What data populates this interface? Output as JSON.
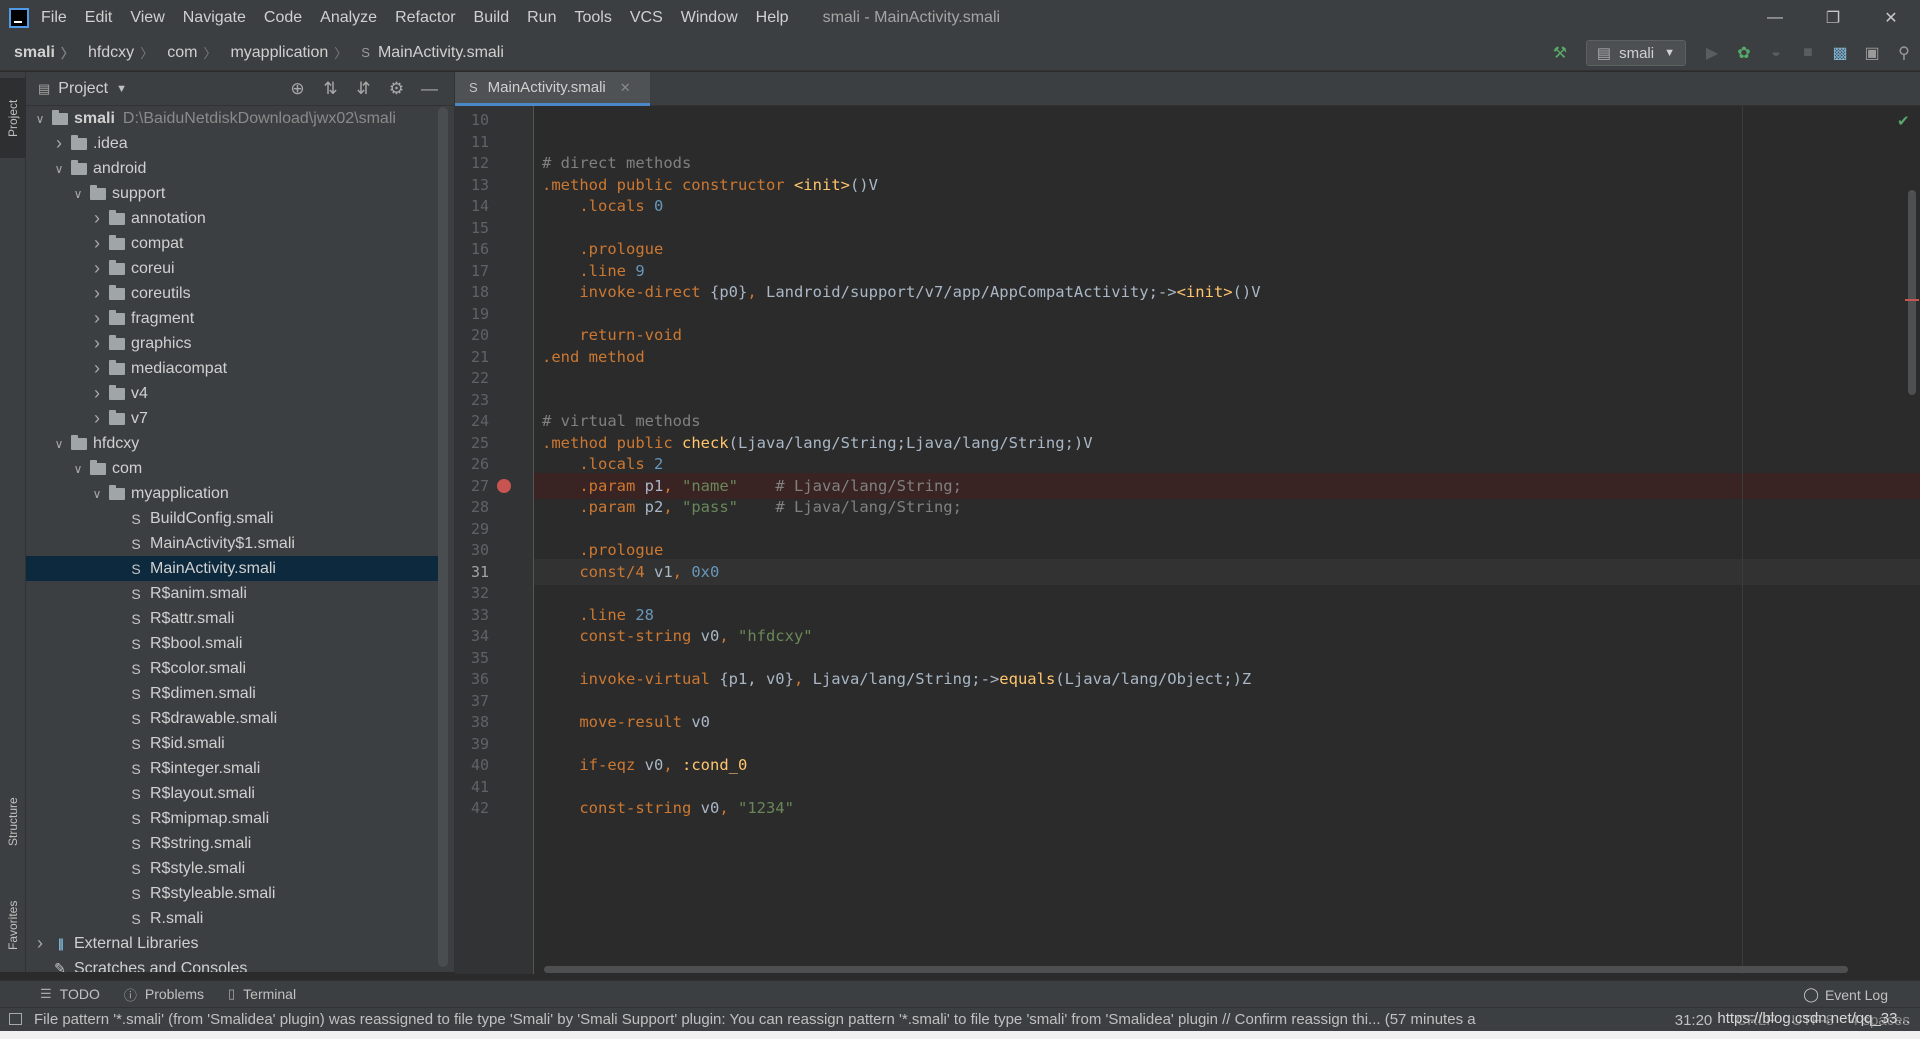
{
  "title_bar": {
    "menus": [
      "File",
      "Edit",
      "View",
      "Navigate",
      "Code",
      "Analyze",
      "Refactor",
      "Build",
      "Run",
      "Tools",
      "VCS",
      "Window",
      "Help"
    ],
    "window_title": "smali - MainActivity.smali"
  },
  "breadcrumb": [
    "smali",
    "hfdcxy",
    "com",
    "myapplication",
    "MainActivity.smali"
  ],
  "run_config": "smali",
  "left_strip": {
    "project": "Project",
    "structure": "Structure",
    "favorites": "Favorites"
  },
  "project_panel": {
    "title": "Project",
    "tree": [
      {
        "label": "smali",
        "path": "D:\\BaiduNetdiskDownload\\jwx02\\smali",
        "kind": "module",
        "depth": 0,
        "expanded": true
      },
      {
        "label": ".idea",
        "kind": "folder",
        "depth": 1,
        "expanded": false
      },
      {
        "label": "android",
        "kind": "folder",
        "depth": 1,
        "expanded": true
      },
      {
        "label": "support",
        "kind": "folder",
        "depth": 2,
        "expanded": true
      },
      {
        "label": "annotation",
        "kind": "folder",
        "depth": 3,
        "expanded": false
      },
      {
        "label": "compat",
        "kind": "folder",
        "depth": 3,
        "expanded": false
      },
      {
        "label": "coreui",
        "kind": "folder",
        "depth": 3,
        "expanded": false
      },
      {
        "label": "coreutils",
        "kind": "folder",
        "depth": 3,
        "expanded": false
      },
      {
        "label": "fragment",
        "kind": "folder",
        "depth": 3,
        "expanded": false
      },
      {
        "label": "graphics",
        "kind": "folder",
        "depth": 3,
        "expanded": false
      },
      {
        "label": "mediacompat",
        "kind": "folder",
        "depth": 3,
        "expanded": false
      },
      {
        "label": "v4",
        "kind": "folder",
        "depth": 3,
        "expanded": false
      },
      {
        "label": "v7",
        "kind": "folder",
        "depth": 3,
        "expanded": false
      },
      {
        "label": "hfdcxy",
        "kind": "folder",
        "depth": 1,
        "expanded": true
      },
      {
        "label": "com",
        "kind": "folder",
        "depth": 2,
        "expanded": true
      },
      {
        "label": "myapplication",
        "kind": "folder",
        "depth": 3,
        "expanded": true
      },
      {
        "label": "BuildConfig.smali",
        "kind": "file",
        "depth": 4
      },
      {
        "label": "MainActivity$1.smali",
        "kind": "file",
        "depth": 4
      },
      {
        "label": "MainActivity.smali",
        "kind": "file",
        "depth": 4,
        "selected": true
      },
      {
        "label": "R$anim.smali",
        "kind": "file",
        "depth": 4
      },
      {
        "label": "R$attr.smali",
        "kind": "file",
        "depth": 4
      },
      {
        "label": "R$bool.smali",
        "kind": "file",
        "depth": 4
      },
      {
        "label": "R$color.smali",
        "kind": "file",
        "depth": 4
      },
      {
        "label": "R$dimen.smali",
        "kind": "file",
        "depth": 4
      },
      {
        "label": "R$drawable.smali",
        "kind": "file",
        "depth": 4
      },
      {
        "label": "R$id.smali",
        "kind": "file",
        "depth": 4
      },
      {
        "label": "R$integer.smali",
        "kind": "file",
        "depth": 4
      },
      {
        "label": "R$layout.smali",
        "kind": "file",
        "depth": 4
      },
      {
        "label": "R$mipmap.smali",
        "kind": "file",
        "depth": 4
      },
      {
        "label": "R$string.smali",
        "kind": "file",
        "depth": 4
      },
      {
        "label": "R$style.smali",
        "kind": "file",
        "depth": 4
      },
      {
        "label": "R$styleable.smali",
        "kind": "file",
        "depth": 4
      },
      {
        "label": "R.smali",
        "kind": "file",
        "depth": 4
      },
      {
        "label": "External Libraries",
        "kind": "library",
        "depth": 0,
        "expanded": false
      },
      {
        "label": "Scratches and Consoles",
        "kind": "scratch",
        "depth": 0
      }
    ]
  },
  "editor": {
    "tab_label": "MainActivity.smali",
    "breakpoint_line": 27,
    "current_line": 31,
    "lines": [
      {
        "n": 10,
        "tokens": []
      },
      {
        "n": 11,
        "tokens": []
      },
      {
        "n": 12,
        "tokens": [
          {
            "t": "# direct methods",
            "c": "cm"
          }
        ]
      },
      {
        "n": 13,
        "tokens": [
          {
            "t": ".method public constructor ",
            "c": "kw"
          },
          {
            "t": "<init>",
            "c": "fn"
          },
          {
            "t": "()V",
            "c": "type"
          }
        ]
      },
      {
        "n": 14,
        "tokens": [
          {
            "t": "    .locals ",
            "c": "kw"
          },
          {
            "t": "0",
            "c": "num"
          }
        ]
      },
      {
        "n": 15,
        "tokens": []
      },
      {
        "n": 16,
        "tokens": [
          {
            "t": "    .prologue",
            "c": "kw"
          }
        ]
      },
      {
        "n": 17,
        "tokens": [
          {
            "t": "    .line ",
            "c": "kw"
          },
          {
            "t": "9",
            "c": "num"
          }
        ]
      },
      {
        "n": 18,
        "tokens": [
          {
            "t": "    invoke-direct ",
            "c": "kw"
          },
          {
            "t": "{p0}",
            "c": "type"
          },
          {
            "t": ", ",
            "c": "kw"
          },
          {
            "t": "Landroid/support/v7/app/AppCompatActivity;->",
            "c": "type"
          },
          {
            "t": "<init>",
            "c": "fn"
          },
          {
            "t": "()V",
            "c": "type"
          }
        ]
      },
      {
        "n": 19,
        "tokens": []
      },
      {
        "n": 20,
        "tokens": [
          {
            "t": "    return-void",
            "c": "kw"
          }
        ]
      },
      {
        "n": 21,
        "tokens": [
          {
            "t": ".end method",
            "c": "kw"
          }
        ]
      },
      {
        "n": 22,
        "tokens": []
      },
      {
        "n": 23,
        "tokens": []
      },
      {
        "n": 24,
        "tokens": [
          {
            "t": "# virtual methods",
            "c": "cm"
          }
        ]
      },
      {
        "n": 25,
        "tokens": [
          {
            "t": ".method public ",
            "c": "kw"
          },
          {
            "t": "check",
            "c": "fn"
          },
          {
            "t": "(Ljava/lang/String;Ljava/lang/String;)V",
            "c": "type"
          }
        ]
      },
      {
        "n": 26,
        "tokens": [
          {
            "t": "    .locals ",
            "c": "kw"
          },
          {
            "t": "2",
            "c": "num"
          }
        ]
      },
      {
        "n": 27,
        "tokens": [
          {
            "t": "    .param ",
            "c": "kw"
          },
          {
            "t": "p1",
            "c": "type"
          },
          {
            "t": ", ",
            "c": "kw"
          },
          {
            "t": "\"name\"",
            "c": "str"
          },
          {
            "t": "    # Ljava/lang/String;",
            "c": "cm"
          }
        ]
      },
      {
        "n": 28,
        "tokens": [
          {
            "t": "    .param ",
            "c": "kw"
          },
          {
            "t": "p2",
            "c": "type"
          },
          {
            "t": ", ",
            "c": "kw"
          },
          {
            "t": "\"pass\"",
            "c": "str"
          },
          {
            "t": "    # Ljava/lang/String;",
            "c": "cm"
          }
        ]
      },
      {
        "n": 29,
        "tokens": []
      },
      {
        "n": 30,
        "tokens": [
          {
            "t": "    .prologue",
            "c": "kw"
          }
        ]
      },
      {
        "n": 31,
        "tokens": [
          {
            "t": "    const/4 ",
            "c": "kw"
          },
          {
            "t": "v1",
            "c": "type"
          },
          {
            "t": ", ",
            "c": "kw"
          },
          {
            "t": "0x0",
            "c": "num"
          }
        ]
      },
      {
        "n": 32,
        "tokens": []
      },
      {
        "n": 33,
        "tokens": [
          {
            "t": "    .line ",
            "c": "kw"
          },
          {
            "t": "28",
            "c": "num"
          }
        ]
      },
      {
        "n": 34,
        "tokens": [
          {
            "t": "    const-string ",
            "c": "kw"
          },
          {
            "t": "v0",
            "c": "type"
          },
          {
            "t": ", ",
            "c": "kw"
          },
          {
            "t": "\"hfdcxy\"",
            "c": "str"
          }
        ]
      },
      {
        "n": 35,
        "tokens": []
      },
      {
        "n": 36,
        "tokens": [
          {
            "t": "    invoke-virtual ",
            "c": "kw"
          },
          {
            "t": "{p1, v0}",
            "c": "type"
          },
          {
            "t": ", ",
            "c": "kw"
          },
          {
            "t": "Ljava/lang/String;->",
            "c": "type"
          },
          {
            "t": "equals",
            "c": "fn"
          },
          {
            "t": "(Ljava/lang/Object;)Z",
            "c": "type"
          }
        ]
      },
      {
        "n": 37,
        "tokens": []
      },
      {
        "n": 38,
        "tokens": [
          {
            "t": "    move-result ",
            "c": "kw"
          },
          {
            "t": "v0",
            "c": "type"
          }
        ]
      },
      {
        "n": 39,
        "tokens": []
      },
      {
        "n": 40,
        "tokens": [
          {
            "t": "    if-eqz ",
            "c": "kw"
          },
          {
            "t": "v0",
            "c": "type"
          },
          {
            "t": ", ",
            "c": "kw"
          },
          {
            "t": ":cond_0",
            "c": "fn"
          }
        ]
      },
      {
        "n": 41,
        "tokens": []
      },
      {
        "n": 42,
        "tokens": [
          {
            "t": "    const-string ",
            "c": "kw"
          },
          {
            "t": "v0",
            "c": "type"
          },
          {
            "t": ", ",
            "c": "kw"
          },
          {
            "t": "\"1234\"",
            "c": "str"
          }
        ]
      }
    ]
  },
  "bottom_tools": {
    "todo": "TODO",
    "problems": "Problems",
    "terminal": "Terminal",
    "event_log": "Event Log"
  },
  "status_bar": {
    "message": "File pattern '*.smali' (from 'Smalidea' plugin) was reassigned to file type 'Smali' by 'Smali Support' plugin: You can reassign pattern '*.smali' to file type 'smali' from 'Smalidea' plugin // Confirm reassign thi... (57 minutes a",
    "position": "31:20",
    "line_sep": "CRLF",
    "encoding": "UTF-8",
    "indent": "4 spaces",
    "watermark": "https://blog.csdn.net/qq_33..."
  },
  "colors": {
    "selection": "#0d293e",
    "tab_underline": "#4a88c7",
    "breakpoint": "#c75450",
    "keyword": "#cc7832",
    "string": "#6a8759",
    "number": "#6897bb",
    "function": "#ffc66d"
  }
}
